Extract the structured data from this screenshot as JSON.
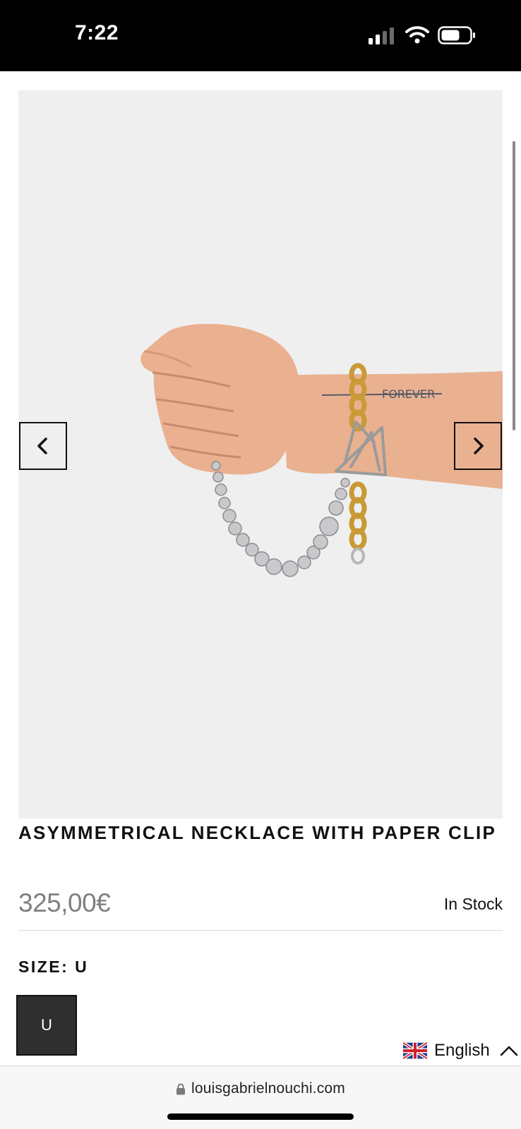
{
  "status_bar": {
    "time": "7:22"
  },
  "product": {
    "title": "ASYMMETRICAL NECKLACE WITH PAPER CLIP",
    "price": "325,00€",
    "availability": "In Stock",
    "size_label": "SIZE: U",
    "size_options": [
      "U"
    ],
    "selected_size": "U"
  },
  "gallery": {
    "prev_icon": "chevron-left-icon",
    "next_icon": "chevron-right-icon",
    "tattoo_text": "FOREVER"
  },
  "language": {
    "label": "English",
    "flag": "uk-flag-icon"
  },
  "browser": {
    "url": "louisgabrielnouchi.com"
  },
  "colors": {
    "status_bar": "#000000",
    "gallery_bg": "#efeff0",
    "selected_size_bg": "#2f2f2f",
    "price": "#7f7f7f"
  }
}
